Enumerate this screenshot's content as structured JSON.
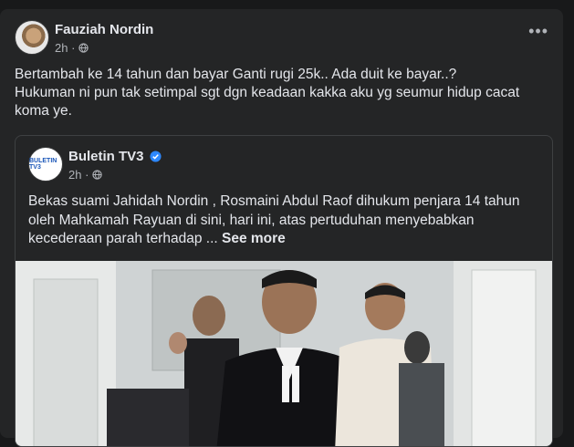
{
  "post": {
    "author": "Fauziah Nordin",
    "time": "2h ·",
    "text": "Bertambah ke 14 tahun dan bayar Ganti rugi 25k.. Ada duit ke bayar..?\nHukuman ni pun tak setimpal sgt dgn keadaan kakka aku yg seumur hidup cacat koma ye.",
    "more_icon": "more-options-icon",
    "audience_icon": "globe-icon"
  },
  "shared": {
    "author": "Buletin TV3",
    "time": "2h ·",
    "logo_text": "BULETIN TV3",
    "text": "Bekas suami Jahidah Nordin , Rosmaini Abdul Raof dihukum penjara 14 tahun oleh Mahkamah Rayuan di sini, hari ini, atas pertuduhan menyebabkan kecederaan parah terhadap ... ",
    "see_more": "See more",
    "verified_icon": "verified-badge-icon"
  },
  "colors": {
    "background": "#18191a",
    "card": "#242526",
    "text": "#e4e6eb",
    "secondary_text": "#b0b3b8",
    "verified": "#2d88ff"
  }
}
